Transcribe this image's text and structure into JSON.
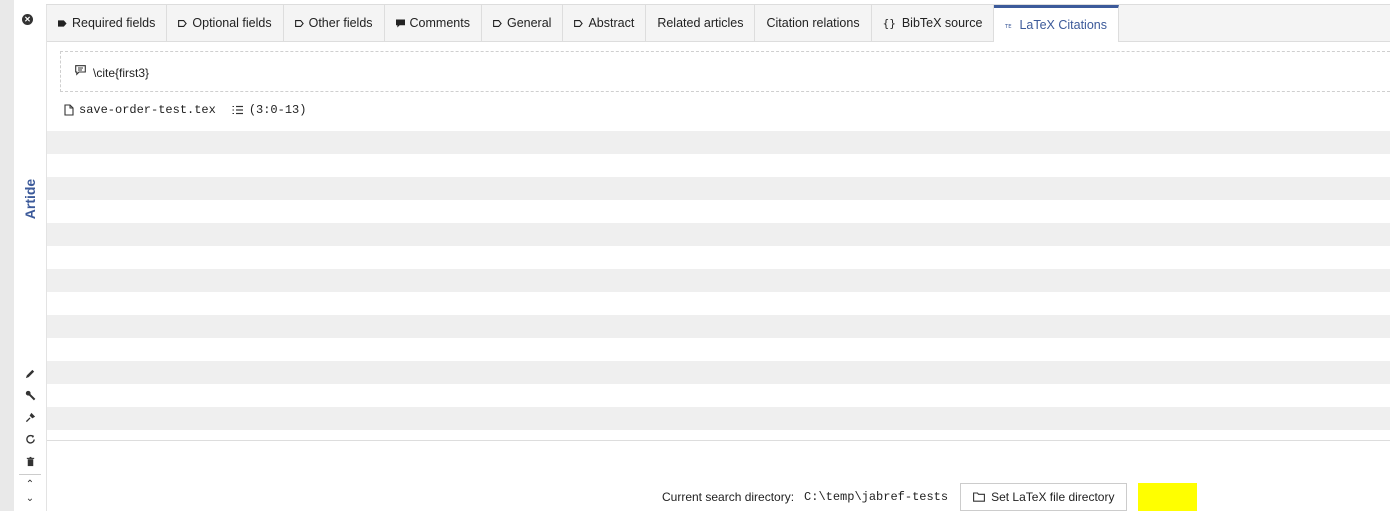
{
  "sidebar": {
    "entry_type": "Artide",
    "tool_icons": [
      "pencil-icon",
      "wrench-icon",
      "brush-icon",
      "refresh-icon",
      "trash-icon"
    ]
  },
  "tabs": [
    {
      "label": "Required fields",
      "icon": "tag-filled-icon"
    },
    {
      "label": "Optional fields",
      "icon": "tag-outline-icon"
    },
    {
      "label": "Other fields",
      "icon": "tag-outline-icon"
    },
    {
      "label": "Comments",
      "icon": "comment-icon"
    },
    {
      "label": "General",
      "icon": "tag-outline-icon"
    },
    {
      "label": "Abstract",
      "icon": "tag-outline-icon"
    },
    {
      "label": "Related articles",
      "icon": ""
    },
    {
      "label": "Citation relations",
      "icon": ""
    },
    {
      "label": "BibTeX source",
      "icon": "braces-icon"
    },
    {
      "label": "LaTeX Citations",
      "icon": "tex-icon",
      "active": true
    }
  ],
  "citation": {
    "key_text": "\\cite{first3}",
    "file": "save-order-test.tex",
    "position": "(3:0-13)"
  },
  "footer": {
    "search_dir_label": "Current search directory:",
    "search_dir": "C:\\temp\\jabref-tests",
    "set_dir_button": "Set LaTeX file directory"
  },
  "colors": {
    "accent": "#3c5a9a",
    "highlight": "#ffff00",
    "row_stripe": "#efefef"
  }
}
